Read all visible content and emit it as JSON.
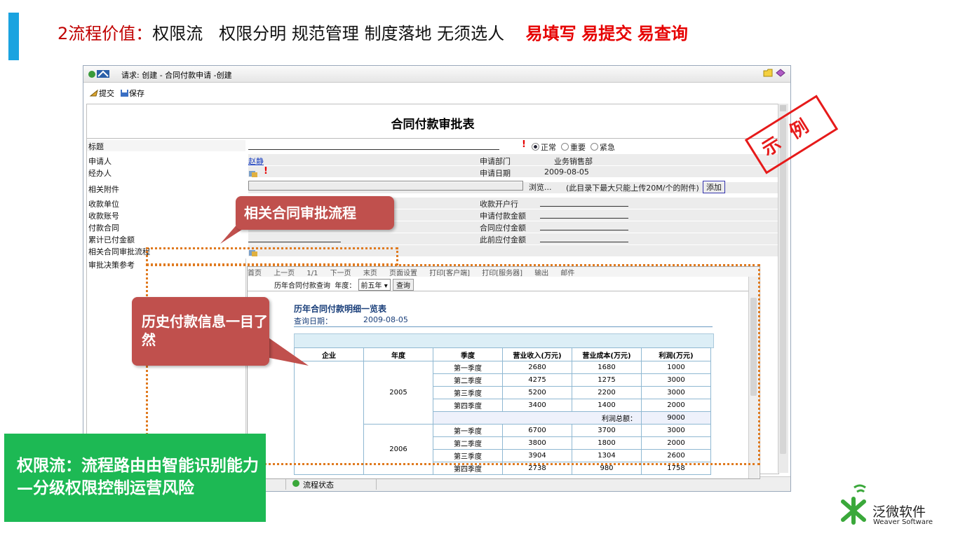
{
  "slide": {
    "title_prefix": "2流程价值：",
    "title_items": [
      "权限流",
      "权限分明",
      "规范管理",
      "制度落地",
      "无须选人"
    ],
    "highlights": [
      "易填写",
      "易提交",
      "易查询"
    ],
    "accent_color": "#1aa3e0"
  },
  "window": {
    "title": "请求: 创建 - 合同付款申请 -创建",
    "toolbar": {
      "submit_label": "提交",
      "save_label": "保存"
    }
  },
  "form": {
    "title": "合同付款审批表",
    "labels": {
      "subject": "标题",
      "applicant": "申请人",
      "handler": "经办人",
      "attachment": "相关附件",
      "payee": "收款单位",
      "payee_account": "收款账号",
      "contract": "付款合同",
      "paid_total": "累计已付金额",
      "related_flow": "相关合同审批流程",
      "decision_ref": "审批决策参考",
      "dept": "申请部门",
      "apply_date": "申请日期",
      "bank": "收款开户行",
      "apply_amount": "申请付款金额",
      "contract_amount": "合同应付金额",
      "prev_amount": "此前应付金额"
    },
    "priority": {
      "normal": "正常",
      "important": "重要",
      "urgent": "紧急",
      "selected": "正常"
    },
    "values": {
      "applicant": "赵静",
      "dept": "业务销售部",
      "apply_date": "2009-08-05"
    },
    "attachment": {
      "browse_label": "浏览...",
      "hint": "(此目录下最大只能上传20M/个的附件)",
      "add_label": "添加"
    }
  },
  "report": {
    "toolbar": [
      "首页",
      "上一页",
      "1/1",
      "下一页",
      "末页",
      "页面设置",
      "打印[客户端]",
      "打印[服务器]",
      "输出",
      "邮件"
    ],
    "query_label": "历年合同付款查询",
    "year_label": "年度：",
    "year_value": "前五年",
    "query_button": "查询",
    "title": "历年合同付款明细一览表",
    "date_label": "查询日期：",
    "date_value": "2009-08-05",
    "columns": [
      "企业",
      "年度",
      "季度",
      "营业收入(万元)",
      "营业成本(万元)",
      "利润(万元)"
    ],
    "groups": [
      {
        "year": "2005",
        "rows": [
          [
            "第一季度",
            "2680",
            "1680",
            "1000"
          ],
          [
            "第二季度",
            "4275",
            "1275",
            "3000"
          ],
          [
            "第三季度",
            "5200",
            "2200",
            "3000"
          ],
          [
            "第四季度",
            "3400",
            "1400",
            "2000"
          ]
        ],
        "total_label": "利润总额：",
        "total": "9000"
      },
      {
        "year": "2006",
        "rows": [
          [
            "第一季度",
            "6700",
            "3700",
            "3000"
          ],
          [
            "第二季度",
            "3800",
            "1800",
            "2000"
          ],
          [
            "第三季度",
            "3904",
            "1304",
            "2600"
          ],
          [
            "第四季度",
            "2738",
            "980",
            "1758"
          ]
        ]
      }
    ]
  },
  "bottom_tabs": {
    "status_tab": "流程状态"
  },
  "callouts": {
    "related_flow": "相关合同审批流程",
    "history": "历史付款信息一目了然",
    "summary": "权限流：流程路由由智能识别能力—分级权限控制运营风险"
  },
  "stamp": {
    "text": "示例",
    "color": "#e61a1a"
  },
  "logo": {
    "name_cn": "泛微软件",
    "name_en": "Weaver Software"
  }
}
